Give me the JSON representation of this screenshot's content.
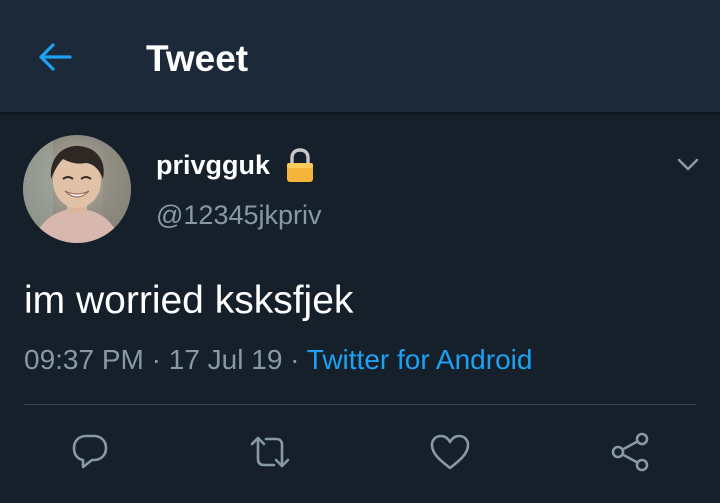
{
  "header": {
    "title": "Tweet",
    "back_icon": "arrow-left-icon"
  },
  "tweet": {
    "display_name": "privgguk",
    "protected_icon": "lock-icon",
    "handle": "@12345jkpriv",
    "text": "im worried ksksfjek",
    "time": "09:37 PM",
    "separator": "·",
    "date": "17 Jul 19",
    "source": "Twitter for Android",
    "more_icon": "chevron-down-icon"
  },
  "actions": [
    {
      "name": "reply",
      "icon": "reply-icon"
    },
    {
      "name": "retweet",
      "icon": "retweet-icon"
    },
    {
      "name": "like",
      "icon": "heart-icon"
    },
    {
      "name": "share",
      "icon": "share-icon"
    }
  ],
  "colors": {
    "background": "#15202b",
    "header": "#1c2938",
    "accent": "#1da1f2",
    "secondary_text": "#8899a6",
    "divider": "#38444d",
    "icon": "#8899a6"
  }
}
